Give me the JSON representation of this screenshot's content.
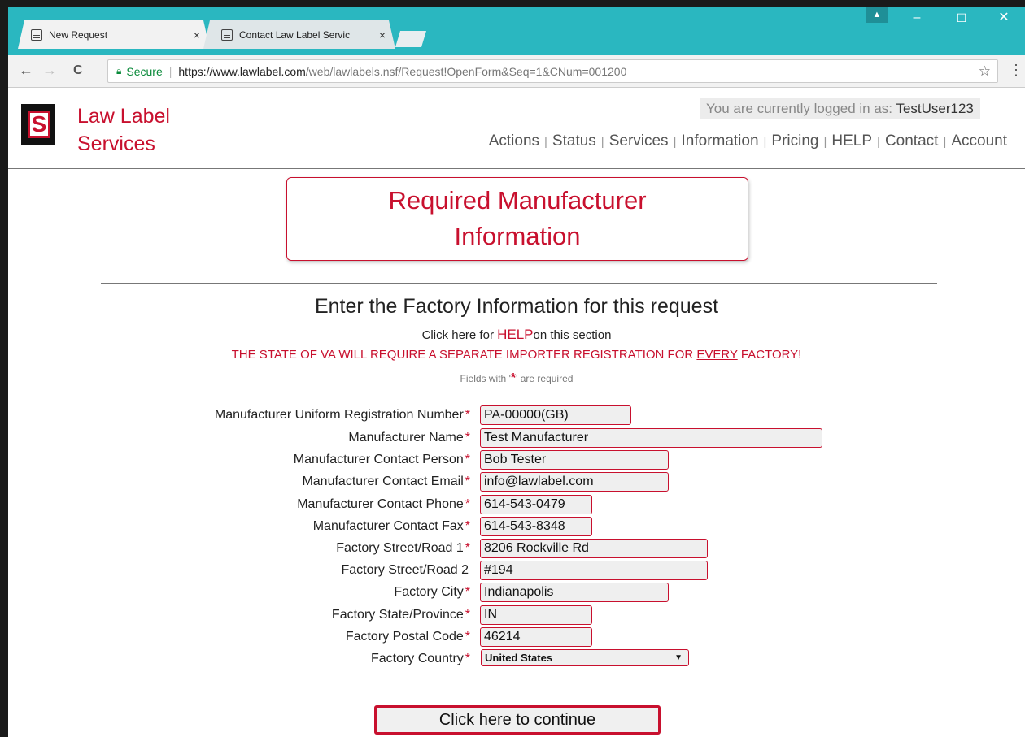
{
  "browser": {
    "tabs": [
      {
        "label": "New Request",
        "close": "×"
      },
      {
        "label": "Contact Law Label Servic",
        "close": "×"
      }
    ],
    "window_controls": {
      "minimize": "–",
      "maximize": "☐",
      "close": "✕"
    },
    "nav": {
      "back": "←",
      "forward": "→",
      "reload": "C"
    },
    "address": {
      "secure_label": "Secure",
      "url_host": "https://www.lawlabel.com",
      "url_path": "/web/lawlabels.nsf/Request!OpenForm&Seq=1&CNum=001200"
    },
    "star": "☆",
    "menu": "⋮"
  },
  "site": {
    "logo_letter": "S",
    "brand_line1": "Law Label",
    "brand_line2": "Services",
    "login_prefix": "You are currently logged in as:",
    "username": "TestUser123",
    "nav_items": [
      "Actions",
      "Status",
      "Services",
      "Information",
      "Pricing",
      "HELP",
      "Contact",
      "Account"
    ],
    "nav_separator": "|"
  },
  "form": {
    "banner_line1": "Required Manufacturer",
    "banner_line2": "Information",
    "heading": "Enter the Factory Information for this request",
    "help_pre": "Click here for ",
    "help_link": "HELP",
    "help_post": "on this section",
    "warning_pre": "THE STATE OF VA WILL REQUIRE A SEPARATE IMPORTER REGISTRATION FOR ",
    "warning_emph": "EVERY",
    "warning_post": " FACTORY!",
    "required_note_pre": "Fields with '",
    "required_note_star": "*",
    "required_note_post": "' are required",
    "fields": [
      {
        "label": "Manufacturer Uniform Registration Number",
        "value": "PA-00000(GB)",
        "required": "*"
      },
      {
        "label": "Manufacturer Name",
        "value": "Test Manufacturer",
        "required": "*"
      },
      {
        "label": "Manufacturer Contact Person",
        "value": "Bob Tester",
        "required": "*"
      },
      {
        "label": "Manufacturer Contact Email",
        "value": "info@lawlabel.com",
        "required": "*"
      },
      {
        "label": "Manufacturer Contact Phone",
        "value": "614-543-0479",
        "required": "*"
      },
      {
        "label": "Manufacturer Contact Fax",
        "value": "614-543-8348",
        "required": "*"
      },
      {
        "label": "Factory Street/Road 1",
        "value": "8206 Rockville Rd",
        "required": "*"
      },
      {
        "label": "Factory Street/Road 2",
        "value": "#194",
        "required": ""
      },
      {
        "label": "Factory City",
        "value": "Indianapolis",
        "required": "*"
      },
      {
        "label": "Factory State/Province",
        "value": "IN",
        "required": "*"
      },
      {
        "label": "Factory Postal Code",
        "value": "46214",
        "required": "*"
      },
      {
        "label": "Factory Country",
        "value": "United States",
        "required": "*"
      }
    ],
    "continue_label": "Click here to continue"
  }
}
